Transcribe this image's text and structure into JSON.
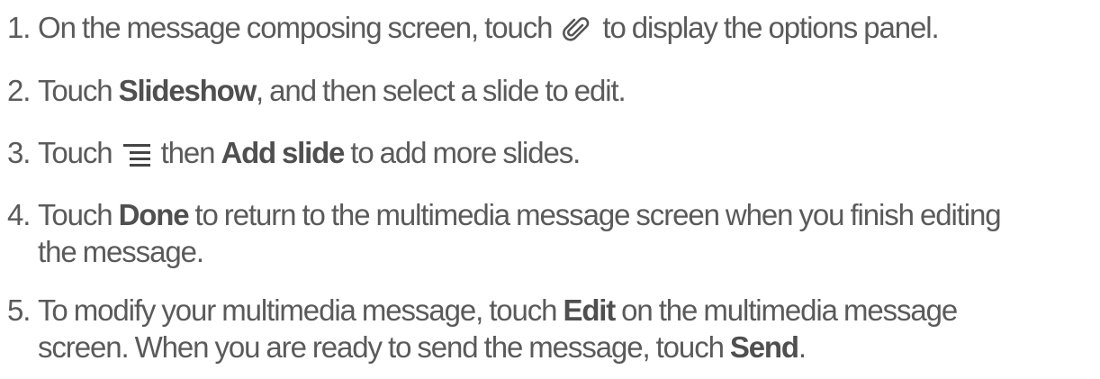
{
  "steps": [
    {
      "number": "1.",
      "text_before": "On the message composing screen, touch",
      "icon": "paperclip-icon",
      "text_after": "to display the options panel."
    },
    {
      "number": "2.",
      "text_before": "Touch ",
      "bold": "Slideshow",
      "text_after": ", and then select a slide to edit."
    },
    {
      "number": "3.",
      "text_before": "Touch",
      "icon": "menu-icon",
      "text_middle": "then ",
      "bold": "Add slide",
      "text_after": " to add more slides."
    },
    {
      "number": "4.",
      "text_before": "Touch ",
      "bold": "Done",
      "text_after": " to return to the multimedia message screen when you finish editing",
      "text_line2": "the message."
    },
    {
      "number": "5.",
      "text_before": "To modify your multimedia message, touch ",
      "bold": "Edit",
      "text_after": " on the multimedia message",
      "text_line2_before": "screen. When you are ready to send the message, touch ",
      "bold2": "Send",
      "text_line2_after": "."
    }
  ]
}
